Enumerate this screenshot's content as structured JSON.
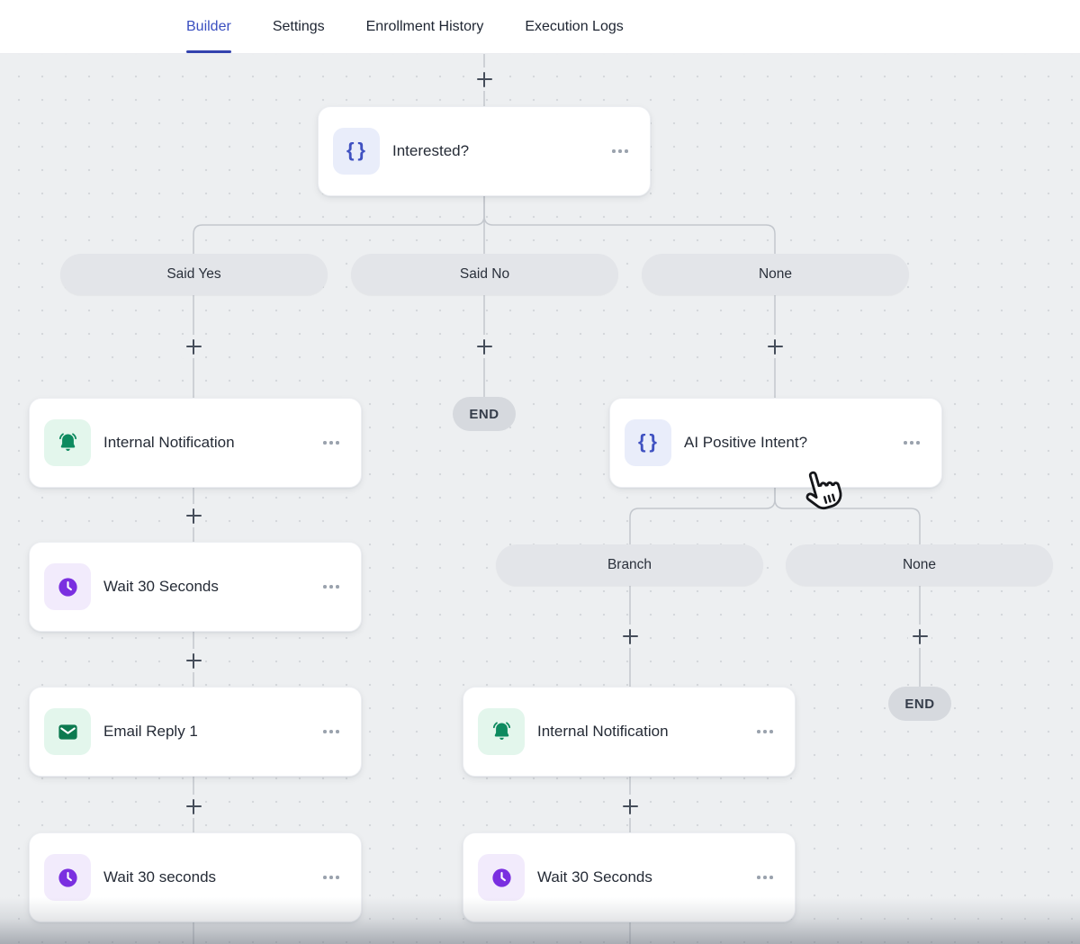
{
  "header": {
    "tabs": [
      {
        "label": "Builder",
        "active": true
      },
      {
        "label": "Settings",
        "active": false
      },
      {
        "label": "Enrollment History",
        "active": false
      },
      {
        "label": "Execution Logs",
        "active": false
      }
    ]
  },
  "flow": {
    "nodes": [
      {
        "title": "Interested?",
        "icon": "braces-icon"
      },
      {
        "title": "Internal Notification",
        "icon": "bell-icon"
      },
      {
        "title": "Wait 30 Seconds",
        "icon": "clock-icon"
      },
      {
        "title": "Email Reply 1",
        "icon": "mail-icon"
      },
      {
        "title": "Wait 30 seconds",
        "icon": "clock-icon"
      },
      {
        "title": "AI Positive Intent?",
        "icon": "braces-icon"
      },
      {
        "title": "Internal Notification",
        "icon": "bell-icon"
      },
      {
        "title": "Wait 30 Seconds",
        "icon": "clock-icon"
      }
    ],
    "branch_labels": [
      {
        "label": "Said Yes"
      },
      {
        "label": "Said No"
      },
      {
        "label": "None"
      },
      {
        "label": "Branch"
      },
      {
        "label": "None"
      }
    ],
    "end_labels": [
      {
        "label": "END"
      },
      {
        "label": "END"
      }
    ]
  },
  "colors": {
    "accent_active_tab": "#3a4fc0",
    "canvas_background": "#edeff1",
    "connector_line": "#c3c7cd",
    "icon_indigo": "#3f51c1",
    "icon_green": "#0d8a5f",
    "icon_purple": "#7a2fe0",
    "pill_background": "#e3e5e9",
    "end_background": "#d6d9de"
  }
}
